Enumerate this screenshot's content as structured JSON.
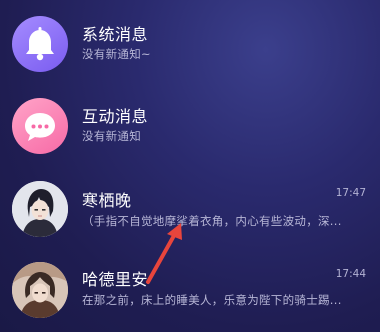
{
  "messages": [
    {
      "title": "系统消息",
      "subtitle": "没有新通知~",
      "time": "",
      "icon": "bell-icon"
    },
    {
      "title": "互动消息",
      "subtitle": "没有新通知",
      "time": "",
      "icon": "chat-bubble-icon"
    },
    {
      "title": "寒栖晚",
      "subtitle": "（手指不自觉地摩挲着衣角，内心有些波动，深...",
      "time": "17:47",
      "icon": "avatar-portrait"
    },
    {
      "title": "哈德里安",
      "subtitle": "在那之前，床上的睡美人，乐意为陛下的骑士踢...",
      "time": "17:44",
      "icon": "avatar-portrait"
    }
  ],
  "colors": {
    "accent_arrow": "#e8453c",
    "bell_bg": "#8f74f7",
    "chat_bg": "#f885b4"
  }
}
